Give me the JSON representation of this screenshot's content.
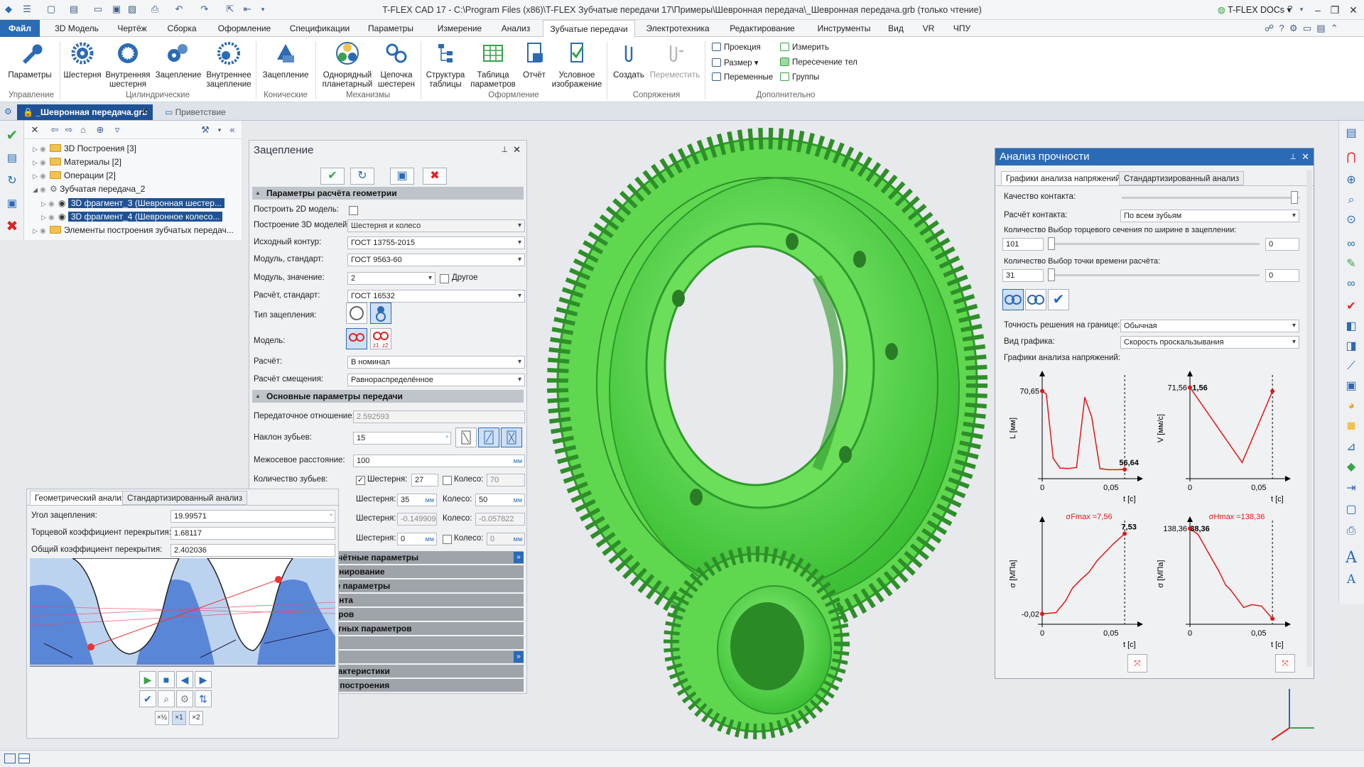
{
  "app": {
    "title": "T-FLEX CAD 17 - C:\\Program Files (x86)\\T-FLEX Зубчатые передачи 17\\Примеры\\Шевронная передача\\_Шевронная передача.grb (только чтение)",
    "docs_label": "T-FLEX DOCs",
    "accent": "#2b6ab5"
  },
  "menu": [
    "Файл",
    "3D Модель",
    "Чертёж",
    "Сборка",
    "Оформление",
    "Спецификации",
    "Параметры",
    "Измерение",
    "Анализ",
    "Зубчатые передачи",
    "Электротехника",
    "Редактирование",
    "Инструменты",
    "Вид",
    "VR",
    "ЧПУ"
  ],
  "ribbon": {
    "buttons": [
      "Параметры",
      "Шестерня",
      "Внутренняя шестерня",
      "Зацепление",
      "Внутреннее зацепление",
      "Зацепление",
      "Однорядный планетарный",
      "Цепочка шестерен",
      "Структура таблицы",
      "Таблица параметров",
      "Отчёт",
      "Условное изображение",
      "Создать",
      "Переместить"
    ],
    "groups": [
      "Управление",
      "Цилиндрические",
      "Конические",
      "Механизмы",
      "Оформление",
      "Сопряжения",
      "Дополнительно"
    ],
    "small": [
      "Проекция",
      "Размер",
      "Переменные",
      "Измерить",
      "Пересечение тел",
      "Группы"
    ]
  },
  "doctabs": [
    "_Шевронная передача.grb",
    "Приветствие"
  ],
  "tree": {
    "items": [
      "3D Построения [3]",
      "Материалы [2]",
      "Операции [2]",
      "Зубчатая передача_2",
      "3D фрагмент_3 (Шевронная шестер...",
      "3D фрагмент_4 (Шевронное колесо...",
      "Элементы построения зубчатых передач..."
    ]
  },
  "prop": {
    "title": "Зацепление",
    "sect_geom": "Параметры расчёта геометрии",
    "rows": [
      {
        "label": "Построить 2D модель:",
        "value": ""
      },
      {
        "label": "Построение 3D моделей:",
        "value": "Шестерня и колесо"
      },
      {
        "label": "Исходный контур:",
        "value": "ГОСТ 13755-2015"
      },
      {
        "label": "Модуль, стандарт:",
        "value": "ГОСТ 9563-60"
      },
      {
        "label": "Модуль, значение:",
        "value": "2"
      },
      {
        "label": "Расчёт, стандарт:",
        "value": "ГОСТ 16532"
      },
      {
        "label": "Тип зацепления:",
        "value": ""
      },
      {
        "label": "Модель:",
        "value": ""
      },
      {
        "label": "Расчёт:",
        "value": "В номинал"
      },
      {
        "label": "Расчёт смещения:",
        "value": "Равнораспределённое"
      }
    ],
    "other_label": "Другое",
    "sect_main": "Основные параметры передачи",
    "ratio_label": "Передаточное отношение:",
    "ratio": "2.592593",
    "tilt_label": "Наклон зубьев:",
    "tilt": "15",
    "dist_label": "Межосевое расстояние:",
    "dist": "100",
    "dist_unit": "мм",
    "teeth_label": "Количество зубьев:",
    "gear_label": "Шестерня:",
    "wheel_label": "Колесо:",
    "teeth_gear": "27",
    "teeth_wheel": "70",
    "width_gear": "35",
    "width_wheel": "50",
    "unit_mm": "мм",
    "shift_gear": "-0.149909",
    "shift_wheel": "-0.057822",
    "last_gear": "0",
    "last_wheel": "0",
    "collapsed": [
      "расчётные параметры",
      "ционирование",
      "ные параметры",
      "умента",
      "метров",
      "счётных параметров",
      "сти",
      "ия",
      "характеристики",
      "сти построения"
    ],
    "two_z1": "z1",
    "two_z2": "z2"
  },
  "geo": {
    "tabs": [
      "Геометрический анализ",
      "Стандартизированный анализ"
    ],
    "rows": [
      {
        "label": "Угол зацепления:",
        "value": "19.99571",
        "unit": "°"
      },
      {
        "label": "Торцевой коэффициент перекрытия:",
        "value": "1.68117",
        "unit": ""
      },
      {
        "label": "Общий коэффициент перекрытия:",
        "value": "2.402036",
        "unit": ""
      }
    ],
    "scale": [
      "×½",
      "×1",
      "×2"
    ]
  },
  "ana": {
    "title": "Анализ прочности",
    "tabs": [
      "Графики анализа напряжений",
      "Стандартизированный анализ"
    ],
    "quality_label": "Качество контакта:",
    "contact_label": "Расчёт контакта:",
    "contact": "По всем зубьям",
    "sect_label": "Количество Выбор торцевого сечения по ширине в зацеплении:",
    "sect_value": "101",
    "sect_pos": "0",
    "time_label": "Количество Выбор точки времени расчёта:",
    "time_value": "31",
    "time_pos": "0",
    "accuracy_label": "Точность решения на границе:",
    "accuracy": "Обычная",
    "graph_label": "Вид графика:",
    "graph": "Скорость проскальзывания",
    "graphs_label": "Графики анализа напряжений:"
  },
  "chart_data": [
    {
      "type": "line",
      "ylabel": "L [мм]",
      "xlabel": "t [с]",
      "tick_top": "70,65",
      "x_ticks": [
        "0",
        "0,05"
      ],
      "end_label": "56,64",
      "x": [
        0,
        0.003,
        0.008,
        0.013,
        0.019,
        0.025,
        0.031,
        0.036,
        0.042,
        0.048,
        0.054,
        0.06
      ],
      "y": [
        70.65,
        70.1,
        58.6,
        56.9,
        56.8,
        57.0,
        69.5,
        66.0,
        56.8,
        56.6,
        56.6,
        56.64
      ],
      "ylim": [
        55,
        73
      ],
      "xlim": [
        0,
        0.062
      ]
    },
    {
      "type": "line",
      "ylabel": "V [мм/с]",
      "xlabel": "t [с]",
      "tick_top": "71,56",
      "x_ticks": [
        "0",
        "0,05"
      ],
      "start_label": "1,56",
      "x": [
        0,
        0.038,
        0.06
      ],
      "y": [
        71.56,
        60.4,
        71.0
      ],
      "ylim": [
        58,
        73
      ],
      "xlim": [
        0,
        0.062
      ]
    },
    {
      "type": "line",
      "ylabel": "σ [МПа]",
      "xlabel": "t [с]",
      "tick_bottom": "-0,02",
      "x_ticks": [
        "0",
        "0,05"
      ],
      "end_label": "7,53",
      "annotation": "σFmax =7,56",
      "x": [
        0,
        0.01,
        0.017,
        0.022,
        0.028,
        0.034,
        0.04,
        0.046,
        0.052,
        0.06
      ],
      "y": [
        -0.02,
        0.1,
        1.2,
        2.4,
        3.2,
        3.9,
        5.0,
        5.8,
        6.6,
        7.53
      ],
      "ylim": [
        -1,
        8.5
      ],
      "xlim": [
        0,
        0.062
      ]
    },
    {
      "type": "line",
      "ylabel": "σ [МПа]",
      "xlabel": "t [с]",
      "tick_top": "138,36",
      "x_ticks": [
        "0",
        "0,05"
      ],
      "start_label": "38,36",
      "annotation": "σHmax =138,36",
      "x": [
        0,
        0.006,
        0.014,
        0.021,
        0.026,
        0.03,
        0.039,
        0.045,
        0.052,
        0.06
      ],
      "y": [
        138.36,
        134,
        120,
        108,
        98,
        94,
        82,
        84,
        83,
        74
      ],
      "ylim": [
        70,
        142
      ],
      "xlim": [
        0,
        0.062
      ]
    }
  ]
}
